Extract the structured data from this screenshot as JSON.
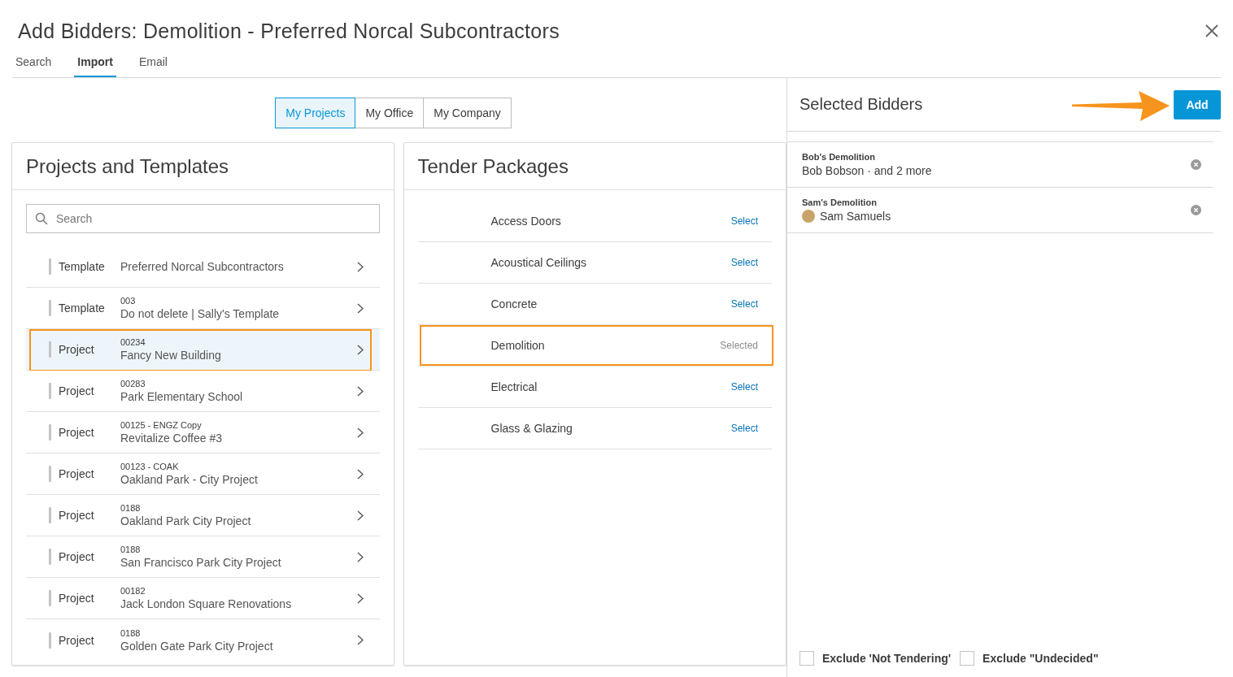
{
  "dialog": {
    "title": "Add Bidders: Demolition - Preferred Norcal Subcontractors"
  },
  "tabs": [
    {
      "label": "Search",
      "selected": false
    },
    {
      "label": "Import",
      "selected": true
    },
    {
      "label": "Email",
      "selected": false
    }
  ],
  "scope": [
    {
      "label": "My Projects",
      "selected": true
    },
    {
      "label": "My Office",
      "selected": false
    },
    {
      "label": "My Company",
      "selected": false
    }
  ],
  "projects_panel": {
    "title": "Projects and Templates",
    "search": {
      "placeholder": "Search"
    },
    "rows": [
      {
        "kind": "Template",
        "name": "Preferred Norcal Subcontractors",
        "selected": false,
        "highlighted": false
      },
      {
        "kind": "Template",
        "code": "003",
        "name": "Do not delete | Sally's Template",
        "selected": false,
        "highlighted": false
      },
      {
        "kind": "Project",
        "code": "00234",
        "name": "Fancy New Building",
        "selected": true,
        "highlighted": true
      },
      {
        "kind": "Project",
        "code": "00283",
        "name": "Park Elementary School",
        "selected": false,
        "highlighted": false
      },
      {
        "kind": "Project",
        "code": "00125 - ENGZ Copy",
        "name": "Revitalize Coffee #3",
        "selected": false,
        "highlighted": false
      },
      {
        "kind": "Project",
        "code": "00123 - COAK",
        "name": "Oakland Park - City Project",
        "selected": false,
        "highlighted": false
      },
      {
        "kind": "Project",
        "code": "0188",
        "name": "Oakland Park City Project",
        "selected": false,
        "highlighted": false
      },
      {
        "kind": "Project",
        "code": "0188",
        "name": "San Francisco Park City Project",
        "selected": false,
        "highlighted": false
      },
      {
        "kind": "Project",
        "code": "00182",
        "name": "Jack London Square Renovations",
        "selected": false,
        "highlighted": false
      },
      {
        "kind": "Project",
        "code": "0188",
        "name": "Golden Gate Park City Project",
        "selected": false,
        "highlighted": false
      }
    ]
  },
  "packages_panel": {
    "title": "Tender Packages",
    "rows": [
      {
        "name": "Access Doors",
        "action": "Select",
        "selected": false,
        "highlighted": false
      },
      {
        "name": "Acoustical Ceilings",
        "action": "Select",
        "selected": false,
        "highlighted": false
      },
      {
        "name": "Concrete",
        "action": "Select",
        "selected": false,
        "highlighted": false
      },
      {
        "name": "Demolition",
        "action": "Selected",
        "selected": true,
        "highlighted": true
      },
      {
        "name": "Electrical",
        "action": "Select",
        "selected": false,
        "highlighted": false
      },
      {
        "name": "Glass & Glazing",
        "action": "Select",
        "selected": false,
        "highlighted": false
      }
    ]
  },
  "selected_panel": {
    "title": "Selected Bidders",
    "add_button": "Add",
    "callout_arrow": true,
    "bidders": [
      {
        "company": "Bob's Demolition",
        "contact": "Bob Bobson · and 2 more",
        "avatar": false
      },
      {
        "company": "Sam's Demolition",
        "contact": "Sam Samuels",
        "avatar": true
      }
    ],
    "options": [
      {
        "label": "Exclude 'Not Tendering'",
        "checked": false
      },
      {
        "label": "Exclude \"Undecided\"",
        "checked": false
      }
    ]
  }
}
